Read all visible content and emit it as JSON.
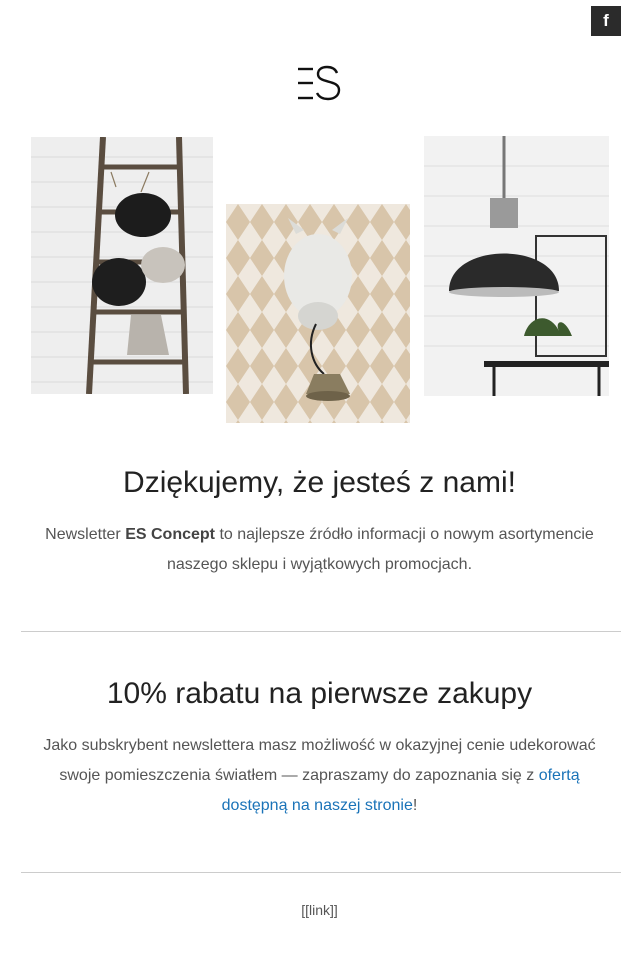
{
  "social": {
    "facebook_label": "f"
  },
  "brand": {
    "logo_text": "ES"
  },
  "intro": {
    "title": "Dziękujemy, że jesteś z nami!",
    "text_before": "Newsletter ",
    "brand_name": "ES Concept",
    "text_after": " to najlepsze źródło informacji o nowym asortymencie naszego sklepu i wyjątkowych promocjach."
  },
  "offer": {
    "title": "10% rabatu na pierwsze zakupy",
    "text_before": "Jako subskrybent newslettera masz możliwość w okazyjnej cenie udekorować swoje pomieszczenia światłem — zapraszamy do zapoznania się z ",
    "link_text": "ofertą dostępną na naszej stronie",
    "text_after": "!"
  },
  "footer": {
    "link_text": "[[link]]"
  },
  "colors": {
    "link": "#1a73b8",
    "rule": "#cccccc",
    "facebook_bg": "#2b2b2b"
  }
}
